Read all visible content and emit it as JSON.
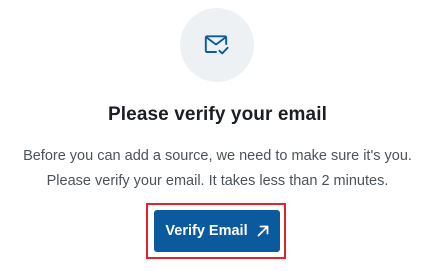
{
  "header": {
    "icon": "mail-check-icon",
    "icon_color": "#0b5a9e",
    "icon_bg": "#eef1f4"
  },
  "title": "Please verify your email",
  "description": {
    "line1": "Before you can add a source, we need to make sure it's you.",
    "line2": "Please verify your email. It takes less than 2 minutes."
  },
  "verify_button": {
    "label": "Verify Email",
    "icon": "external-arrow-icon",
    "bg_color": "#0b5a9e",
    "text_color": "#ffffff"
  },
  "highlight": {
    "color": "#e3222a"
  }
}
